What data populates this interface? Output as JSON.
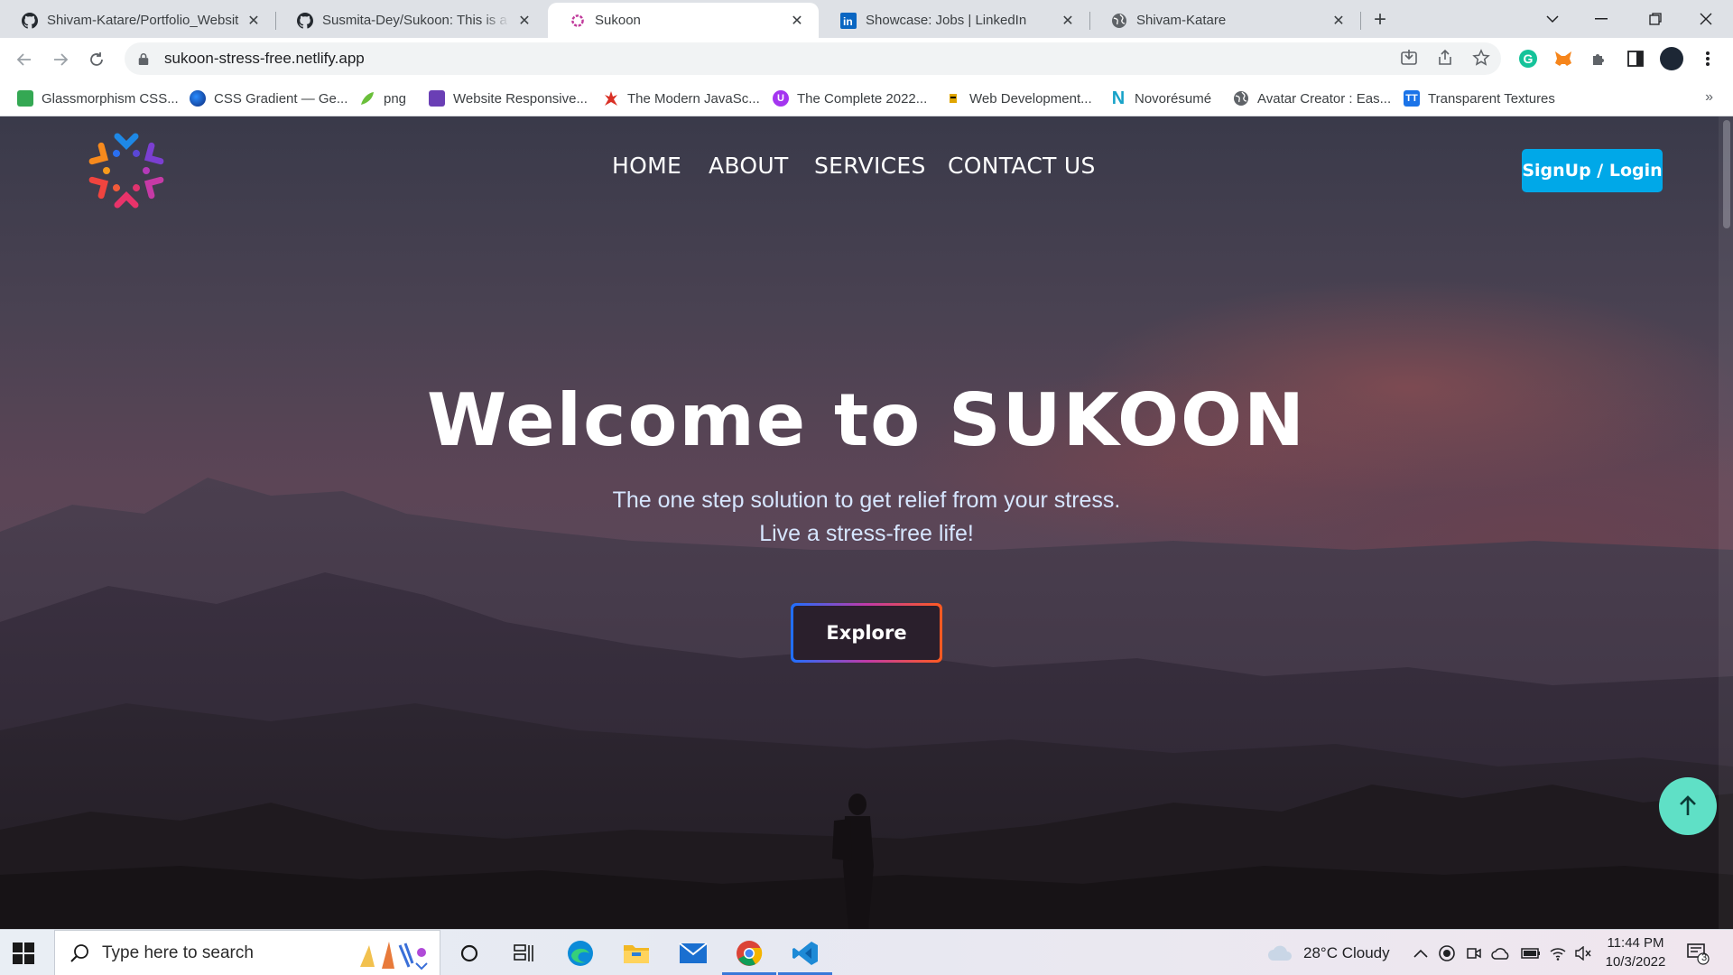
{
  "browser": {
    "tabs": [
      {
        "title": "Shivam-Katare/Portfolio_Website",
        "icon": "github-icon",
        "active": false
      },
      {
        "title": "Susmita-Dey/Sukoon: This is a str",
        "icon": "github-icon",
        "active": false
      },
      {
        "title": "Sukoon",
        "icon": "sukoon-favicon",
        "active": true
      },
      {
        "title": "Showcase: Jobs | LinkedIn",
        "icon": "linkedin-icon",
        "active": false
      },
      {
        "title": "Shivam-Katare",
        "icon": "globe-icon",
        "active": false
      }
    ],
    "url": "sukoon-stress-free.netlify.app",
    "bookmarks": [
      {
        "label": "Glassmorphism CSS...",
        "icon": "glassmorphism-icon",
        "color": "#34a853"
      },
      {
        "label": "CSS Gradient — Ge...",
        "icon": "cssgradient-icon",
        "color": "#1a56c4"
      },
      {
        "label": "png",
        "icon": "leaf-icon",
        "color": "#6abf3a"
      },
      {
        "label": "Website Responsive...",
        "icon": "responsive-icon",
        "color": "#6a3fb5"
      },
      {
        "label": "The Modern JavaSc...",
        "icon": "javascript-icon",
        "color": "#d93025"
      },
      {
        "label": "The Complete 2022...",
        "icon": "udemy-icon",
        "color": "#a435f0"
      },
      {
        "label": "Web Development...",
        "icon": "webdev-icon",
        "color": "#e0a500"
      },
      {
        "label": "Novorésumé",
        "icon": "novoresume-icon",
        "color": "#17a2c8"
      },
      {
        "label": "Avatar Creator : Eas...",
        "icon": "globe-icon",
        "color": "#5f6368"
      },
      {
        "label": "Transparent Textures",
        "icon": "textures-icon",
        "color": "#1a73e8"
      }
    ]
  },
  "site": {
    "nav": [
      "HOME",
      "ABOUT",
      "SERVICES",
      "CONTACT US"
    ],
    "signup_label": "SignUp / Login",
    "hero_title": "Welcome to SUKOON",
    "hero_line1": "The one step solution to get relief from your stress.",
    "hero_line2": "Live a stress-free life!",
    "cta_label": "Explore",
    "colors": {
      "accent": "#00a8e8",
      "to_top": "#5fe0c6",
      "cta_gradient_start": "#1e6fff",
      "cta_gradient_end": "#ff5a1f"
    }
  },
  "taskbar": {
    "search_placeholder": "Type here to search",
    "weather": "28°C  Cloudy",
    "time": "11:44 PM",
    "date": "10/3/2022",
    "notification_count": "3"
  }
}
